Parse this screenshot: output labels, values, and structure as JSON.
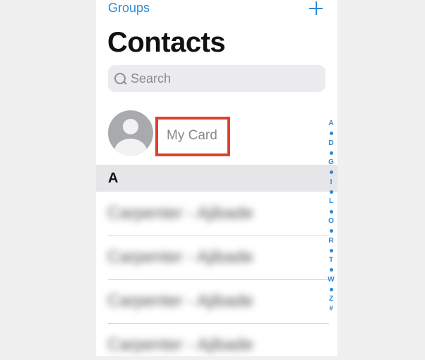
{
  "header": {
    "groups_label": "Groups",
    "add_icon": "plus-icon"
  },
  "title": "Contacts",
  "search": {
    "placeholder": "Search",
    "icon": "magnifier-icon"
  },
  "my_card": {
    "label": "My Card",
    "avatar_icon": "person-silhouette-icon",
    "highlight_color": "#e0402e"
  },
  "section": {
    "letter": "A"
  },
  "contacts": [
    {
      "name": "Carpenter - Ajibade"
    },
    {
      "name": "Carpenter - Ajibade"
    },
    {
      "name": "Carpenter - Ajibade"
    },
    {
      "name": "Carpenter - Ajibade"
    }
  ],
  "index": [
    "A",
    "•",
    "D",
    "•",
    "G",
    "•",
    "I",
    "•",
    "L",
    "•",
    "O",
    "•",
    "R",
    "•",
    "T",
    "•",
    "W",
    "•",
    "Z",
    "#"
  ],
  "colors": {
    "accent": "#2a8ad8",
    "background": "#ffffff",
    "section_bg": "#e6e6e8"
  }
}
